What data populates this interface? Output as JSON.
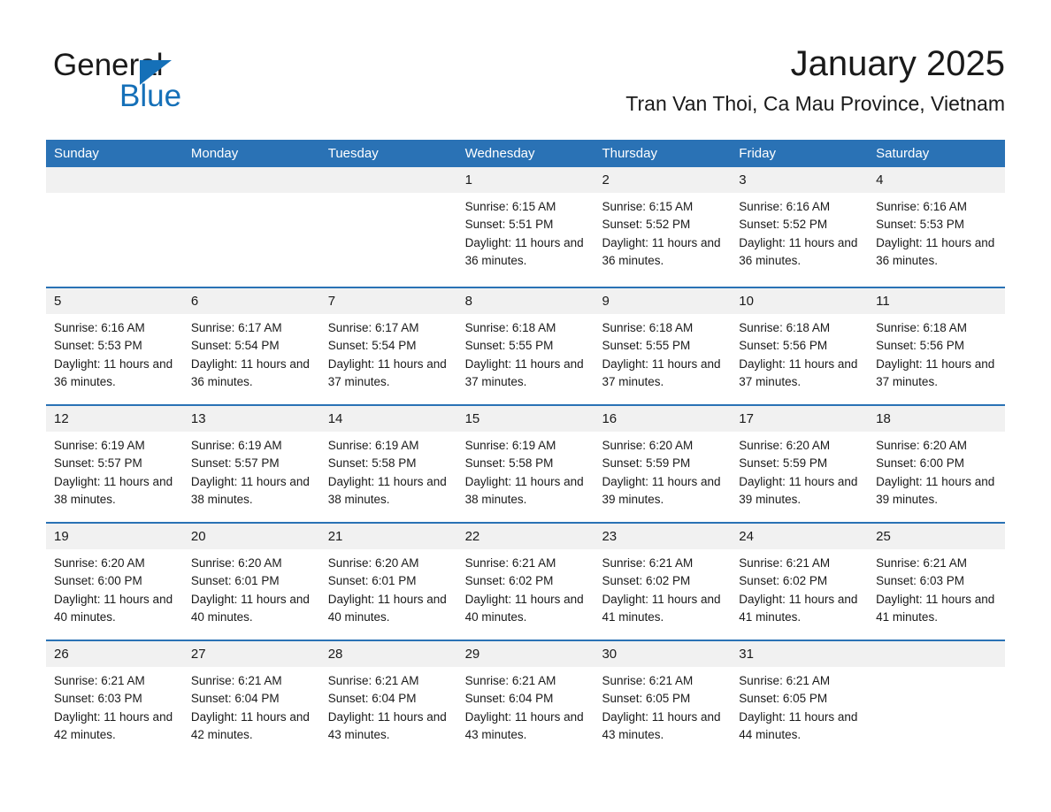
{
  "brand": {
    "name_top": "General",
    "name_bottom": "Blue",
    "triangle_color": "#1570b8",
    "text_color": "#1a1a1a"
  },
  "header": {
    "title": "January 2025",
    "subtitle": "Tran Van Thoi, Ca Mau Province, Vietnam"
  },
  "theme": {
    "header_blue": "#2a72b5",
    "day_band_gray": "#f1f1f1",
    "text": "#1a1a1a",
    "white": "#ffffff"
  },
  "calendar": {
    "weekdays": [
      "Sunday",
      "Monday",
      "Tuesday",
      "Wednesday",
      "Thursday",
      "Friday",
      "Saturday"
    ],
    "weeks": [
      [
        {
          "day": "",
          "sunrise": "",
          "sunset": "",
          "daylight": ""
        },
        {
          "day": "",
          "sunrise": "",
          "sunset": "",
          "daylight": ""
        },
        {
          "day": "",
          "sunrise": "",
          "sunset": "",
          "daylight": ""
        },
        {
          "day": "1",
          "sunrise": "Sunrise: 6:15 AM",
          "sunset": "Sunset: 5:51 PM",
          "daylight": "Daylight: 11 hours and 36 minutes."
        },
        {
          "day": "2",
          "sunrise": "Sunrise: 6:15 AM",
          "sunset": "Sunset: 5:52 PM",
          "daylight": "Daylight: 11 hours and 36 minutes."
        },
        {
          "day": "3",
          "sunrise": "Sunrise: 6:16 AM",
          "sunset": "Sunset: 5:52 PM",
          "daylight": "Daylight: 11 hours and 36 minutes."
        },
        {
          "day": "4",
          "sunrise": "Sunrise: 6:16 AM",
          "sunset": "Sunset: 5:53 PM",
          "daylight": "Daylight: 11 hours and 36 minutes."
        }
      ],
      [
        {
          "day": "5",
          "sunrise": "Sunrise: 6:16 AM",
          "sunset": "Sunset: 5:53 PM",
          "daylight": "Daylight: 11 hours and 36 minutes."
        },
        {
          "day": "6",
          "sunrise": "Sunrise: 6:17 AM",
          "sunset": "Sunset: 5:54 PM",
          "daylight": "Daylight: 11 hours and 36 minutes."
        },
        {
          "day": "7",
          "sunrise": "Sunrise: 6:17 AM",
          "sunset": "Sunset: 5:54 PM",
          "daylight": "Daylight: 11 hours and 37 minutes."
        },
        {
          "day": "8",
          "sunrise": "Sunrise: 6:18 AM",
          "sunset": "Sunset: 5:55 PM",
          "daylight": "Daylight: 11 hours and 37 minutes."
        },
        {
          "day": "9",
          "sunrise": "Sunrise: 6:18 AM",
          "sunset": "Sunset: 5:55 PM",
          "daylight": "Daylight: 11 hours and 37 minutes."
        },
        {
          "day": "10",
          "sunrise": "Sunrise: 6:18 AM",
          "sunset": "Sunset: 5:56 PM",
          "daylight": "Daylight: 11 hours and 37 minutes."
        },
        {
          "day": "11",
          "sunrise": "Sunrise: 6:18 AM",
          "sunset": "Sunset: 5:56 PM",
          "daylight": "Daylight: 11 hours and 37 minutes."
        }
      ],
      [
        {
          "day": "12",
          "sunrise": "Sunrise: 6:19 AM",
          "sunset": "Sunset: 5:57 PM",
          "daylight": "Daylight: 11 hours and 38 minutes."
        },
        {
          "day": "13",
          "sunrise": "Sunrise: 6:19 AM",
          "sunset": "Sunset: 5:57 PM",
          "daylight": "Daylight: 11 hours and 38 minutes."
        },
        {
          "day": "14",
          "sunrise": "Sunrise: 6:19 AM",
          "sunset": "Sunset: 5:58 PM",
          "daylight": "Daylight: 11 hours and 38 minutes."
        },
        {
          "day": "15",
          "sunrise": "Sunrise: 6:19 AM",
          "sunset": "Sunset: 5:58 PM",
          "daylight": "Daylight: 11 hours and 38 minutes."
        },
        {
          "day": "16",
          "sunrise": "Sunrise: 6:20 AM",
          "sunset": "Sunset: 5:59 PM",
          "daylight": "Daylight: 11 hours and 39 minutes."
        },
        {
          "day": "17",
          "sunrise": "Sunrise: 6:20 AM",
          "sunset": "Sunset: 5:59 PM",
          "daylight": "Daylight: 11 hours and 39 minutes."
        },
        {
          "day": "18",
          "sunrise": "Sunrise: 6:20 AM",
          "sunset": "Sunset: 6:00 PM",
          "daylight": "Daylight: 11 hours and 39 minutes."
        }
      ],
      [
        {
          "day": "19",
          "sunrise": "Sunrise: 6:20 AM",
          "sunset": "Sunset: 6:00 PM",
          "daylight": "Daylight: 11 hours and 40 minutes."
        },
        {
          "day": "20",
          "sunrise": "Sunrise: 6:20 AM",
          "sunset": "Sunset: 6:01 PM",
          "daylight": "Daylight: 11 hours and 40 minutes."
        },
        {
          "day": "21",
          "sunrise": "Sunrise: 6:20 AM",
          "sunset": "Sunset: 6:01 PM",
          "daylight": "Daylight: 11 hours and 40 minutes."
        },
        {
          "day": "22",
          "sunrise": "Sunrise: 6:21 AM",
          "sunset": "Sunset: 6:02 PM",
          "daylight": "Daylight: 11 hours and 40 minutes."
        },
        {
          "day": "23",
          "sunrise": "Sunrise: 6:21 AM",
          "sunset": "Sunset: 6:02 PM",
          "daylight": "Daylight: 11 hours and 41 minutes."
        },
        {
          "day": "24",
          "sunrise": "Sunrise: 6:21 AM",
          "sunset": "Sunset: 6:02 PM",
          "daylight": "Daylight: 11 hours and 41 minutes."
        },
        {
          "day": "25",
          "sunrise": "Sunrise: 6:21 AM",
          "sunset": "Sunset: 6:03 PM",
          "daylight": "Daylight: 11 hours and 41 minutes."
        }
      ],
      [
        {
          "day": "26",
          "sunrise": "Sunrise: 6:21 AM",
          "sunset": "Sunset: 6:03 PM",
          "daylight": "Daylight: 11 hours and 42 minutes."
        },
        {
          "day": "27",
          "sunrise": "Sunrise: 6:21 AM",
          "sunset": "Sunset: 6:04 PM",
          "daylight": "Daylight: 11 hours and 42 minutes."
        },
        {
          "day": "28",
          "sunrise": "Sunrise: 6:21 AM",
          "sunset": "Sunset: 6:04 PM",
          "daylight": "Daylight: 11 hours and 43 minutes."
        },
        {
          "day": "29",
          "sunrise": "Sunrise: 6:21 AM",
          "sunset": "Sunset: 6:04 PM",
          "daylight": "Daylight: 11 hours and 43 minutes."
        },
        {
          "day": "30",
          "sunrise": "Sunrise: 6:21 AM",
          "sunset": "Sunset: 6:05 PM",
          "daylight": "Daylight: 11 hours and 43 minutes."
        },
        {
          "day": "31",
          "sunrise": "Sunrise: 6:21 AM",
          "sunset": "Sunset: 6:05 PM",
          "daylight": "Daylight: 11 hours and 44 minutes."
        },
        {
          "day": "",
          "sunrise": "",
          "sunset": "",
          "daylight": ""
        }
      ]
    ]
  }
}
